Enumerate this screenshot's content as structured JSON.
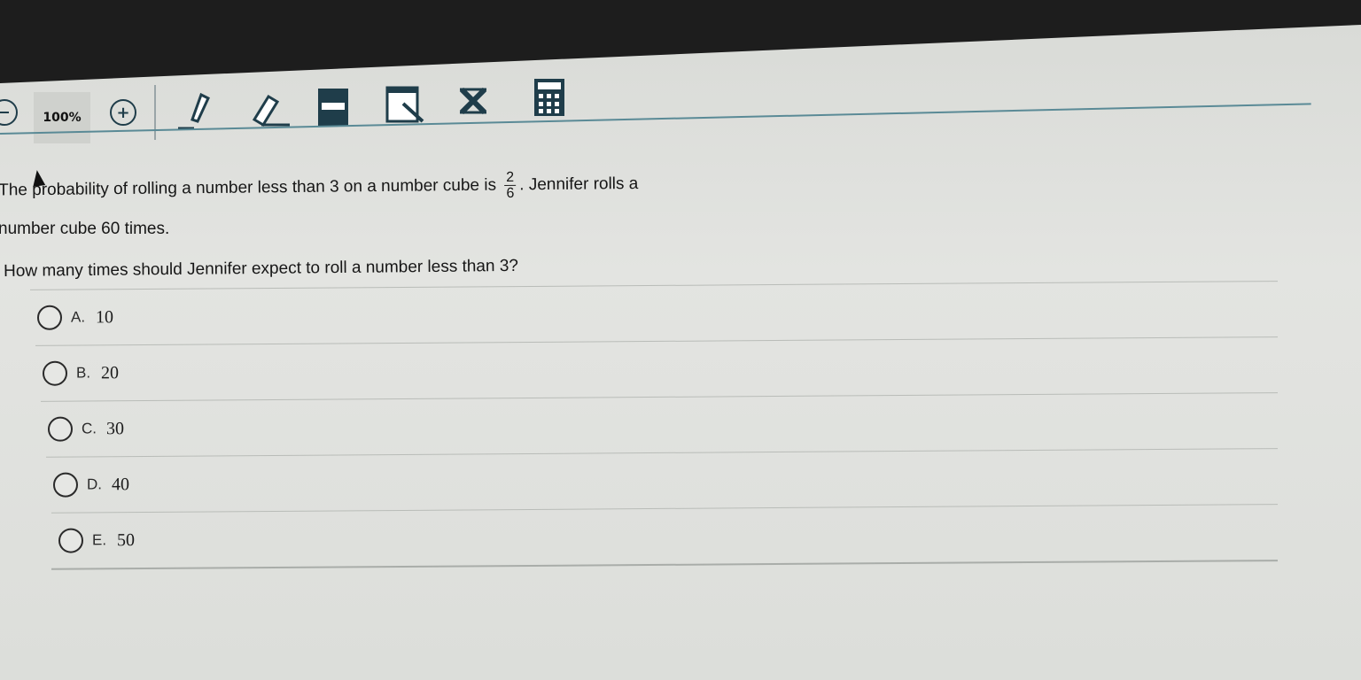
{
  "toolbar": {
    "zoom_level": "100%",
    "tools": [
      {
        "name": "zoom-out-icon"
      },
      {
        "name": "zoom-in-icon"
      },
      {
        "name": "highlighter-icon"
      },
      {
        "name": "eraser-icon"
      },
      {
        "name": "line-reader-icon"
      },
      {
        "name": "notepad-icon"
      },
      {
        "name": "answer-eliminator-icon"
      },
      {
        "name": "calculator-icon"
      }
    ],
    "accent_color": "#1f3d4a"
  },
  "question": {
    "line1_before": "The probability of rolling a number less than 3 on a number cube is",
    "fraction_numerator": "2",
    "fraction_denominator": "6",
    "line1_after": ". Jennifer rolls a",
    "line2": "number cube 60 times.",
    "prompt": "How many times should Jennifer expect to roll a number less than 3?"
  },
  "choices": [
    {
      "letter": "A.",
      "text": "10"
    },
    {
      "letter": "B.",
      "text": "20"
    },
    {
      "letter": "C.",
      "text": "30"
    },
    {
      "letter": "D.",
      "text": "40"
    },
    {
      "letter": "E.",
      "text": "50"
    }
  ]
}
